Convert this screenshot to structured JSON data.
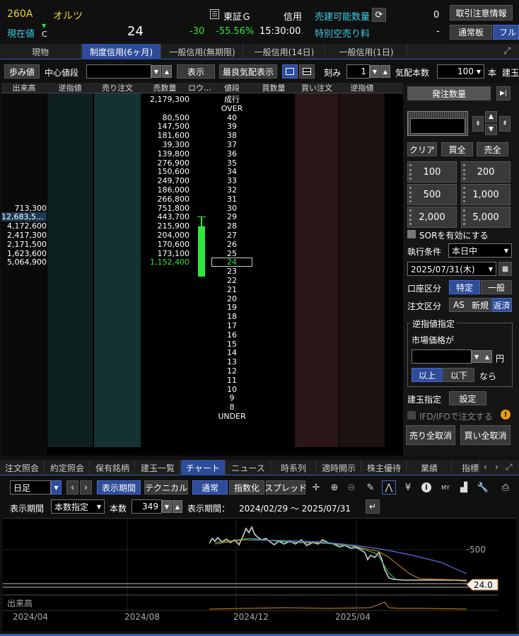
{
  "header": {
    "code": "260A",
    "name": "オルツ",
    "current_price_label": "現在値",
    "mark_arrow": "▼",
    "mark": "C",
    "price": "24",
    "change": "-30",
    "change_pct": "-55.56%",
    "time": "15:30:00",
    "market": "東証Ｇ",
    "credit": "信用",
    "sellable_label": "売建可能数量",
    "sellable_value": "0",
    "short_fee_label": "特別空売り料",
    "short_fee_value": "-",
    "notice_button": "取引注意情報",
    "normal_board": "通常板",
    "full_board": "フル"
  },
  "tabs": [
    "現物",
    "制度信用(6ヶ月)",
    "一般信用(無期限)",
    "一般信用(14日)",
    "一般信用(1日)"
  ],
  "toolbar": {
    "ticks_button": "歩み値",
    "center_label": "中心値段",
    "center_value": "",
    "show_button": "表示",
    "best_button": "最良気配表示",
    "tick_label": "刻み",
    "tick_value": "1",
    "depth_label": "気配本数",
    "depth_value": "100",
    "depth_unit": "本",
    "build_label": "建玉"
  },
  "board": {
    "headers": [
      "出来高",
      "逆指値",
      "売り注文",
      "売数量",
      "ロウ…",
      "値段",
      "買数量",
      "買い注文",
      "逆指値"
    ],
    "rows": [
      {
        "vol": "",
        "sell_qty": "2,179,300",
        "price": "成行"
      },
      {
        "vol": "",
        "sell_qty": "",
        "price": "OVER"
      },
      {
        "vol": "",
        "sell_qty": "80,500",
        "price": "40"
      },
      {
        "vol": "",
        "sell_qty": "147,500",
        "price": "39"
      },
      {
        "vol": "",
        "sell_qty": "181,600",
        "price": "38"
      },
      {
        "vol": "",
        "sell_qty": "39,300",
        "price": "37"
      },
      {
        "vol": "",
        "sell_qty": "139,800",
        "price": "36"
      },
      {
        "vol": "",
        "sell_qty": "276,900",
        "price": "35"
      },
      {
        "vol": "",
        "sell_qty": "150,600",
        "price": "34"
      },
      {
        "vol": "",
        "sell_qty": "249,700",
        "price": "33"
      },
      {
        "vol": "",
        "sell_qty": "186,000",
        "price": "32"
      },
      {
        "vol": "",
        "sell_qty": "266,800",
        "price": "31"
      },
      {
        "vol": "713,300",
        "sell_qty": "751,800",
        "price": "30"
      },
      {
        "vol": "12,683,5...",
        "sell_qty": "443,700",
        "price": "29"
      },
      {
        "vol": "4,172,600",
        "sell_qty": "215,900",
        "price": "28"
      },
      {
        "vol": "2,417,300",
        "sell_qty": "204,000",
        "price": "27"
      },
      {
        "vol": "2,171,500",
        "sell_qty": "170,600",
        "price": "26"
      },
      {
        "vol": "1,623,600",
        "sell_qty": "173,100",
        "price": "25"
      },
      {
        "vol": "5,064,900",
        "sell_qty": "1,152,400",
        "price": "24"
      },
      {
        "vol": "",
        "sell_qty": "",
        "price": "23"
      },
      {
        "vol": "",
        "sell_qty": "",
        "price": "22"
      },
      {
        "vol": "",
        "sell_qty": "",
        "price": "21"
      },
      {
        "vol": "",
        "sell_qty": "",
        "price": "20"
      },
      {
        "vol": "",
        "sell_qty": "",
        "price": "19"
      },
      {
        "vol": "",
        "sell_qty": "",
        "price": "18"
      },
      {
        "vol": "",
        "sell_qty": "",
        "price": "17"
      },
      {
        "vol": "",
        "sell_qty": "",
        "price": "16"
      },
      {
        "vol": "",
        "sell_qty": "",
        "price": "15"
      },
      {
        "vol": "",
        "sell_qty": "",
        "price": "14"
      },
      {
        "vol": "",
        "sell_qty": "",
        "price": "13"
      },
      {
        "vol": "",
        "sell_qty": "",
        "price": "12"
      },
      {
        "vol": "",
        "sell_qty": "",
        "price": "11"
      },
      {
        "vol": "",
        "sell_qty": "",
        "price": "10"
      },
      {
        "vol": "",
        "sell_qty": "",
        "price": "9"
      },
      {
        "vol": "",
        "sell_qty": "",
        "price": "8"
      },
      {
        "vol": "",
        "sell_qty": "",
        "price": "UNDER"
      }
    ]
  },
  "order": {
    "qty_button": "発注数量",
    "qty_value": "",
    "clear": "クリア",
    "buy_all": "買全",
    "sell_all": "売全",
    "amounts": [
      "100",
      "200",
      "500",
      "1,000",
      "2,000",
      "5,000"
    ],
    "sor_label": "SORを有効にする",
    "exec_label": "執行条件",
    "exec_value": "本日中",
    "date_value": "2025/07/31(木)",
    "account_label": "口座区分",
    "account_specific": "特定",
    "account_general": "一般",
    "order_type_label": "注文区分",
    "order_as": "AS",
    "order_new": "新規",
    "order_close": "返済",
    "stop_title": "逆指値指定",
    "market_price_label": "市場価格が",
    "stop_price_value": "",
    "yen": "円",
    "above": "以上",
    "below": "以下",
    "then": "なら",
    "position_label": "建玉指定",
    "settings": "設定",
    "ifd_label": "IFD/IFOで注文する",
    "cancel_sell": "売り全取消",
    "cancel_buy": "買い全取消"
  },
  "chart_tabs": [
    "注文照会",
    "約定照会",
    "保有銘柄",
    "建玉一覧",
    "チャート",
    "ニュース",
    "時系列",
    "適時開示",
    "株主優待",
    "業績",
    "指標"
  ],
  "chart_toolbar": {
    "period_type": "日足",
    "range_button": "表示期間",
    "technical_button": "テクニカル",
    "mode_normal": "通常",
    "mode_index": "指数化",
    "mode_spread": "スプレッド",
    "range_label": "表示期間",
    "range_mode": "本数指定",
    "count_label": "本数",
    "count_value": "349",
    "range_text_label": "表示期間：",
    "range_text": "2024/02/29 ～ 2025/07/31"
  },
  "chart": {
    "price_tick": "500",
    "last_price": "24.0",
    "volume_label": "出来高",
    "x_ticks": [
      "2024/04",
      "2024/08",
      "2024/12",
      "2025/04"
    ]
  }
}
